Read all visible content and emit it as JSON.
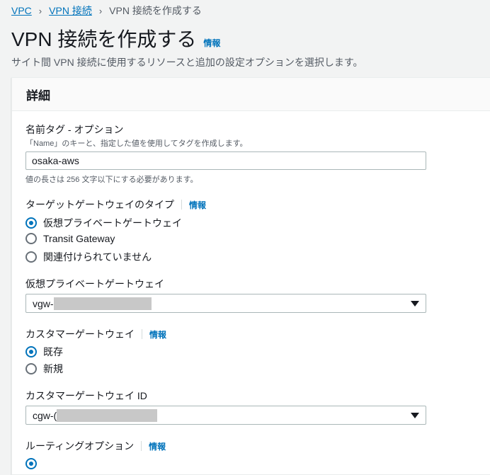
{
  "breadcrumb": {
    "items": [
      "VPC",
      "VPN 接続"
    ],
    "current": "VPN 接続を作成する",
    "separator": "›"
  },
  "page": {
    "title": "VPN 接続を作成する",
    "info": "情報",
    "description": "サイト間 VPN 接続に使用するリソースと追加の設定オプションを選択します。"
  },
  "panel": {
    "title": "詳細",
    "name_tag": {
      "label": "名前タグ - オプション",
      "hint": "「Name」のキーと、指定した値を使用してタグを作成します。",
      "value": "osaka-aws",
      "constraint": "値の長さは 256 文字以下にする必要があります。"
    },
    "target_gateway_type": {
      "label": "ターゲットゲートウェイのタイプ",
      "info": "情報",
      "options": [
        "仮想プライベートゲートウェイ",
        "Transit Gateway",
        "関連付けられていません"
      ],
      "selected_index": 0
    },
    "vgw": {
      "label": "仮想プライベートゲートウェイ",
      "value_prefix": "vgw-"
    },
    "customer_gateway": {
      "label": "カスタマーゲートウェイ",
      "info": "情報",
      "options": [
        "既存",
        "新規"
      ],
      "selected_index": 0
    },
    "cgw": {
      "label": "カスタマーゲートウェイ ID",
      "value_prefix": "cgw-("
    },
    "routing": {
      "label": "ルーティングオプション",
      "info": "情報"
    }
  },
  "colors": {
    "link": "#0073bb",
    "background": "#f2f3f3",
    "panel": "#ffffff",
    "radio_selected": "#0073bb",
    "mask": "#c8c8c8"
  }
}
